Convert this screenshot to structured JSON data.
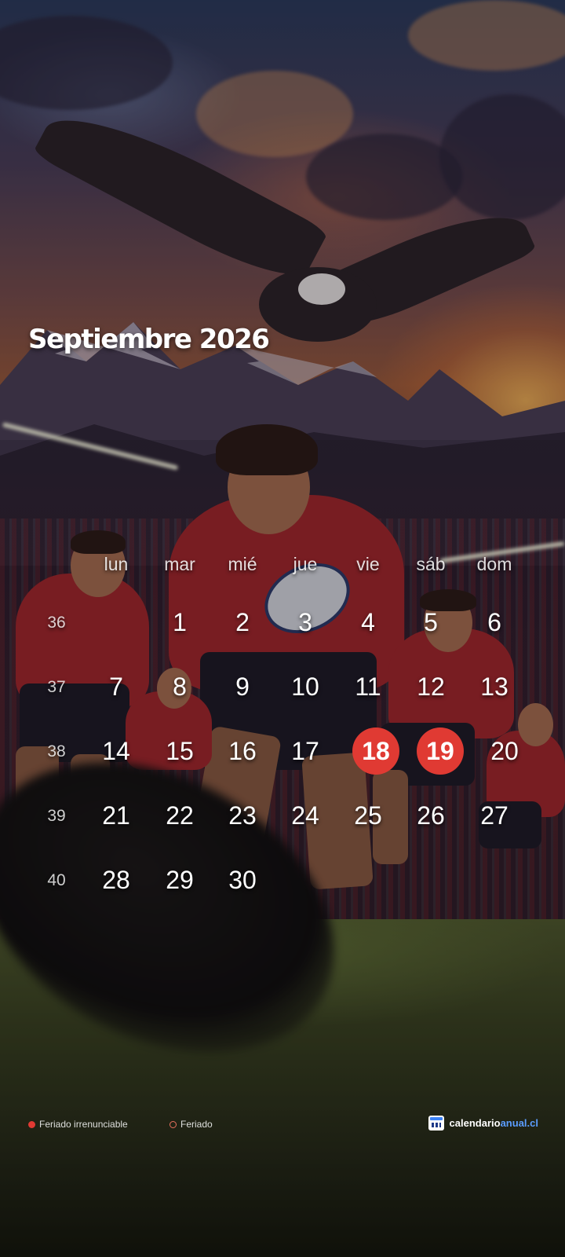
{
  "calendar": {
    "title": "Septiembre 2026",
    "weekdays": [
      "lun",
      "mar",
      "mié",
      "jue",
      "vie",
      "sáb",
      "dom"
    ],
    "weeks": [
      {
        "number": "36",
        "days": [
          "",
          "1",
          "2",
          "3",
          "4",
          "5",
          "6"
        ]
      },
      {
        "number": "37",
        "days": [
          "7",
          "8",
          "9",
          "10",
          "11",
          "12",
          "13"
        ]
      },
      {
        "number": "38",
        "days": [
          "14",
          "15",
          "16",
          "17",
          "18",
          "19",
          "20"
        ]
      },
      {
        "number": "39",
        "days": [
          "21",
          "22",
          "23",
          "24",
          "25",
          "26",
          "27"
        ]
      },
      {
        "number": "40",
        "days": [
          "28",
          "29",
          "30",
          "",
          "",
          "",
          ""
        ]
      }
    ],
    "irrenunciable_holidays": [
      "18",
      "19"
    ],
    "holiday_color": "#e03a33"
  },
  "legend": {
    "irrenunciable_label": "Feriado irrenunciable",
    "holiday_label": "Feriado"
  },
  "brand": {
    "name_main": "calendario",
    "name_accent": "anual.cl",
    "icon": "calendar-icon"
  },
  "background": {
    "description_icon": "rugby-wallpaper-image"
  }
}
